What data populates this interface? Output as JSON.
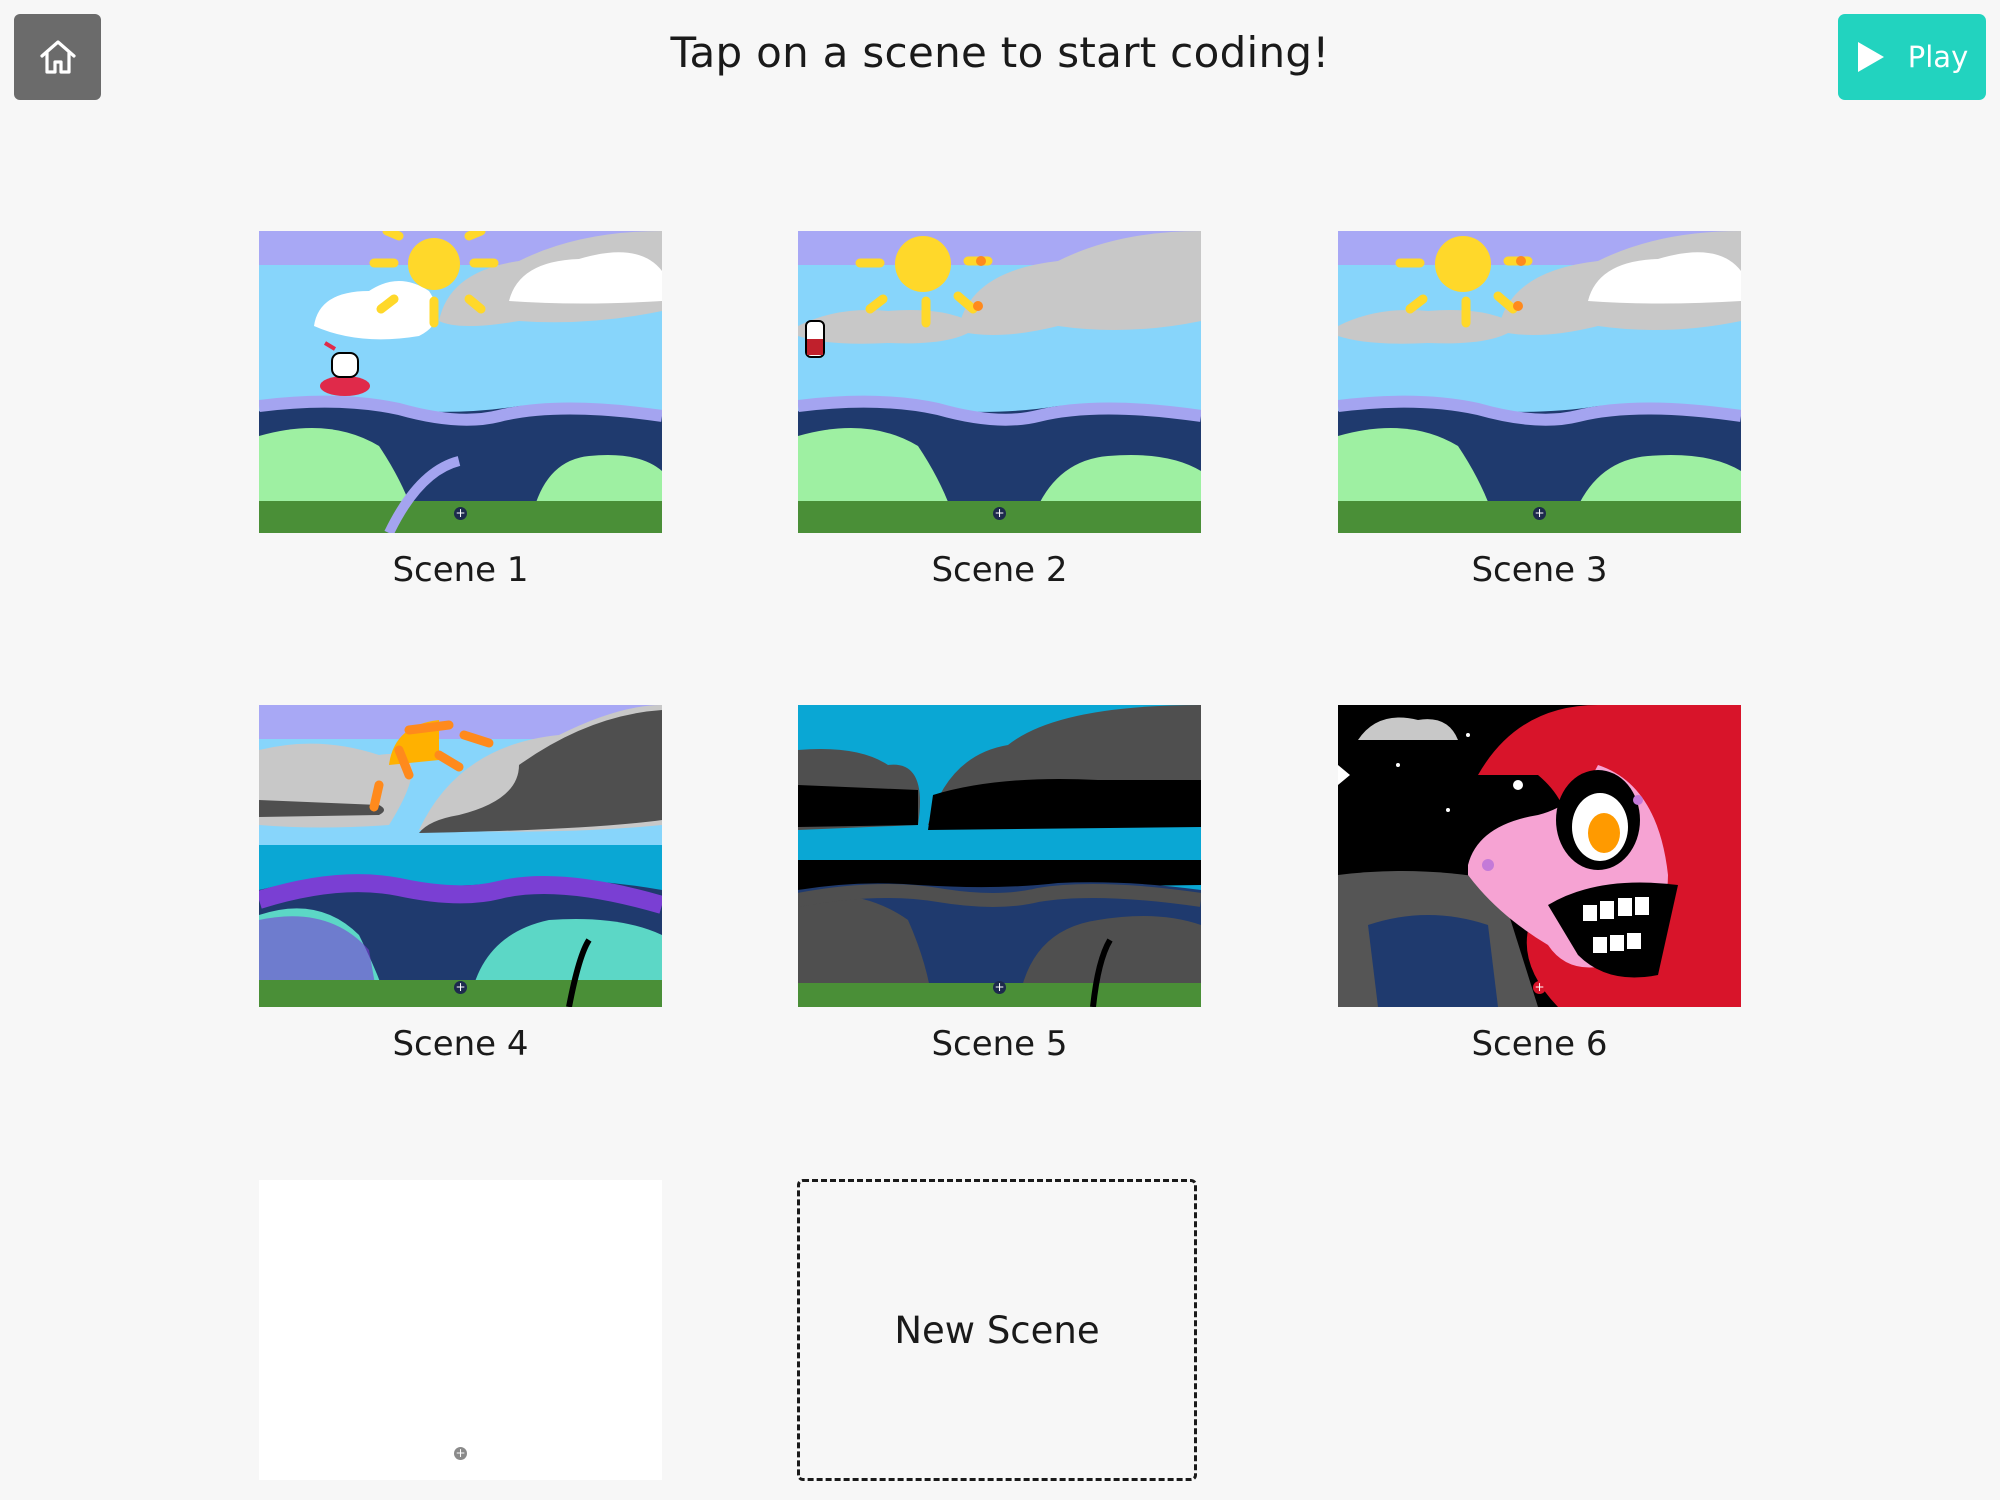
{
  "header": {
    "title": "Tap on a scene to start coding!",
    "play_label": "Play",
    "home_icon": "home-icon",
    "play_icon": "play-icon"
  },
  "scenes": [
    {
      "label": "Scene 1"
    },
    {
      "label": "Scene 2"
    },
    {
      "label": "Scene 3"
    },
    {
      "label": "Scene 4"
    },
    {
      "label": "Scene 5"
    },
    {
      "label": "Scene 6"
    },
    {
      "label": ""
    }
  ],
  "new_scene": {
    "label": "New Scene"
  },
  "colors": {
    "play_button": "#22d3bf",
    "home_button": "#6b6b6b",
    "background": "#f7f7f7"
  }
}
